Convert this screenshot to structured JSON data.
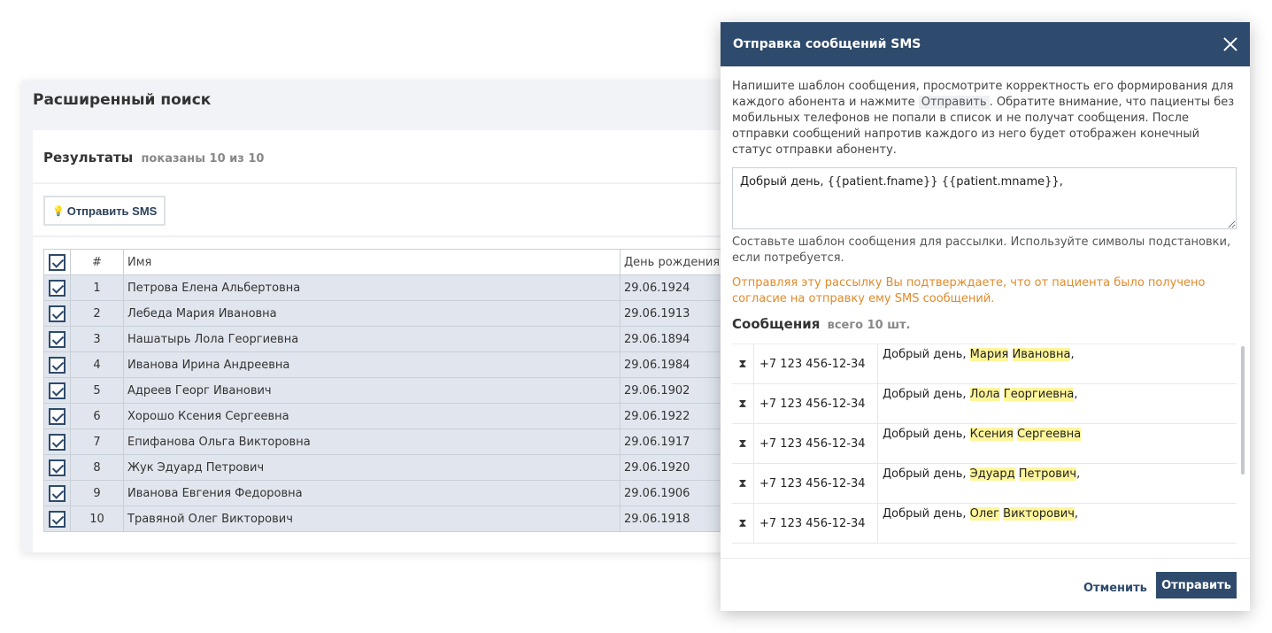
{
  "search": {
    "title": "Расширенный поиск",
    "results_title": "Результаты",
    "results_sub": "показаны 10 из 10",
    "send_sms_label": "Отправить SMS",
    "columns": [
      "#",
      "Имя",
      "День рождения"
    ],
    "rows": [
      {
        "num": "1",
        "name": "Петрова Елена Альбертовна",
        "birth": "29.06.1924"
      },
      {
        "num": "2",
        "name": "Лебеда Мария Ивановна",
        "birth": "29.06.1913"
      },
      {
        "num": "3",
        "name": "Нашатырь Лола Георгиевна",
        "birth": "29.06.1894"
      },
      {
        "num": "4",
        "name": "Иванова Ирина Андреевна",
        "birth": "29.06.1984"
      },
      {
        "num": "5",
        "name": "Адреев Георг Иванович",
        "birth": "29.06.1902"
      },
      {
        "num": "6",
        "name": "Хорошо Ксения Сергеевна",
        "birth": "29.06.1922"
      },
      {
        "num": "7",
        "name": "Епифанова Ольга Викторовна",
        "birth": "29.06.1917"
      },
      {
        "num": "8",
        "name": "Жук Эдуард Петрович",
        "birth": "29.06.1920"
      },
      {
        "num": "9",
        "name": "Иванова Евгения Федоровна",
        "birth": "29.06.1906"
      },
      {
        "num": "10",
        "name": "Травяной Олег Викторович",
        "birth": "29.06.1918"
      }
    ]
  },
  "modal": {
    "title": "Отправка сообщений SMS",
    "intro_1": "Напишите шаблон сообщения, просмотрите корректность его формирования для каждого абонента и нажмите",
    "intro_kbd": "Отправить",
    "intro_2": ". Обратите внимание, что пациенты без мобильных телефонов не попали в список и не получат сообщения. После отправки сообщений напротив каждого из него будет отображен конечный статус отправки абоненту.",
    "template_value": "Добрый день, {{patient.fname}} {{patient.mname}},",
    "hint": "Составьте шаблон сообщения для рассылки. Используйте символы подстановки, если потребуется.",
    "warning": "Отправляя эту рассылку Вы подтверждаете, что от пациента было получено согласие на отправку ему SMS сообщений.",
    "messages_title": "Сообщения",
    "messages_sub": "всего 10 шт.",
    "messages": [
      {
        "phone": "+7 123 456-12-34",
        "prefix": "Добрый день, ",
        "fname": "Мария",
        "mname": "Ивановна",
        "suffix": ","
      },
      {
        "phone": "+7 123 456-12-34",
        "prefix": "Добрый день, ",
        "fname": "Лола",
        "mname": "Георгиевна",
        "suffix": ","
      },
      {
        "phone": "+7 123 456-12-34",
        "prefix": "Добрый день, ",
        "fname": "Ксения",
        "mname": "Сергеевна",
        "suffix": ""
      },
      {
        "phone": "+7 123 456-12-34",
        "prefix": "Добрый день, ",
        "fname": "Эдуард",
        "mname": "Петрович",
        "suffix": ","
      },
      {
        "phone": "+7 123 456-12-34",
        "prefix": "Добрый день, ",
        "fname": "Олег",
        "mname": "Викторович",
        "suffix": ","
      }
    ],
    "cancel_label": "Отменить",
    "send_label": "Отправить"
  }
}
